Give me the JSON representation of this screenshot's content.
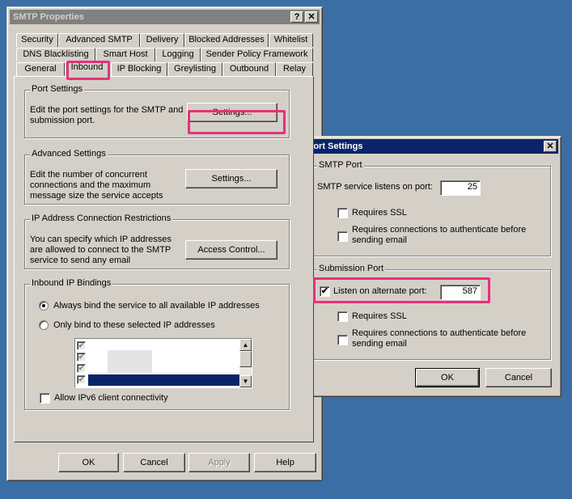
{
  "main_window": {
    "title": "SMTP Properties",
    "help_btn": "?",
    "close_btn": "✕",
    "tabs_row1": [
      "Security",
      "Advanced SMTP",
      "Delivery",
      "Blocked Addresses",
      "Whitelist"
    ],
    "tabs_row2": [
      "DNS Blacklisting",
      "Smart Host",
      "Logging",
      "Sender Policy Framework"
    ],
    "tabs_row3": [
      "General",
      "Inbound",
      "IP Blocking",
      "Greylisting",
      "Outbound",
      "Relay"
    ],
    "selected_tab": "Inbound",
    "port_settings": {
      "title": "Port Settings",
      "desc1": "Edit the port settings for the SMTP and",
      "desc2": "submission port.",
      "button": "Settings..."
    },
    "advanced_settings": {
      "title": "Advanced Settings",
      "desc1": "Edit the number of concurrent",
      "desc2": "connections and the maximum",
      "desc3": "message size the service accepts",
      "button": "Settings..."
    },
    "ip_restrictions": {
      "title": "IP Address Connection Restrictions",
      "desc1": "You can specify which IP addresses",
      "desc2": "are allowed to connect to the SMTP",
      "desc3": "service to send any email",
      "button": "Access Control..."
    },
    "ip_bindings": {
      "title": "Inbound IP Bindings",
      "radio_all": "Always bind the service to all available IP addresses",
      "radio_selected": "Only bind to these selected IP addresses",
      "radio_all_selected": true,
      "ipv6_label": "Allow IPv6 client connectivity",
      "ipv6_checked": false
    },
    "buttons": {
      "ok": "OK",
      "cancel": "Cancel",
      "apply": "Apply",
      "help": "Help"
    }
  },
  "port_dialog": {
    "title": "Port Settings",
    "close_btn": "✕",
    "smtp_port": {
      "title": "SMTP Port",
      "listen_label": "SMTP service listens on port:",
      "port_value": "25",
      "requires_ssl": "Requires SSL",
      "requires_auth1": "Requires connections to authenticate before",
      "requires_auth2": "sending email"
    },
    "submission_port": {
      "title": "Submission Port",
      "listen_label": "Listen on alternate port:",
      "listen_checked": true,
      "port_value": "587",
      "requires_ssl": "Requires SSL",
      "requires_auth1": "Requires connections to authenticate before",
      "requires_auth2": "sending email"
    },
    "buttons": {
      "ok": "OK",
      "cancel": "Cancel"
    }
  },
  "colors": {
    "desktop": "#3a6ea5",
    "highlight": "#e8307a",
    "title_active": "#0a246a",
    "title_inactive": "#808080"
  }
}
